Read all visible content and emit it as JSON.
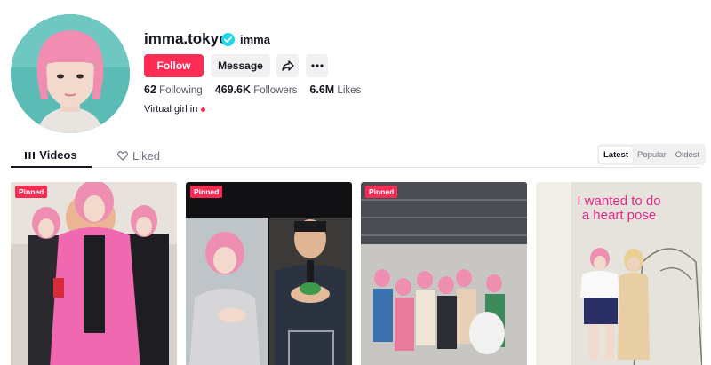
{
  "profile": {
    "username": "imma.tokyo",
    "nickname": "imma",
    "verified": true,
    "bio": "Virtual girl in",
    "avatar_icon": "avatar-photo",
    "verified_icon": "verified-badge-icon",
    "colors": {
      "accent": "#fe2c55",
      "verified": "#20d5ec",
      "text": "#161823"
    }
  },
  "actions": {
    "follow_label": "Follow",
    "message_label": "Message",
    "share_icon": "share-arrow-icon",
    "more_icon": "more-dots-icon"
  },
  "stats": [
    {
      "value": "62",
      "label": "Following"
    },
    {
      "value": "469.6K",
      "label": "Followers"
    },
    {
      "value": "6.6M",
      "label": "Likes"
    }
  ],
  "tabs": [
    {
      "label": "Videos",
      "icon": "grid-icon",
      "active": true
    },
    {
      "label": "Liked",
      "icon": "heart-lock-icon",
      "active": false
    }
  ],
  "sort": [
    {
      "label": "Latest",
      "active": true
    },
    {
      "label": "Popular",
      "active": false
    },
    {
      "label": "Oldest",
      "active": false
    }
  ],
  "videos": [
    {
      "badge": "Pinned",
      "overlay_text": ""
    },
    {
      "badge": "Pinned",
      "overlay_text": ""
    },
    {
      "badge": "Pinned",
      "overlay_text": ""
    },
    {
      "badge": "",
      "overlay_text_line1": "I wanted to do",
      "overlay_text_line2": "a heart pose"
    }
  ]
}
